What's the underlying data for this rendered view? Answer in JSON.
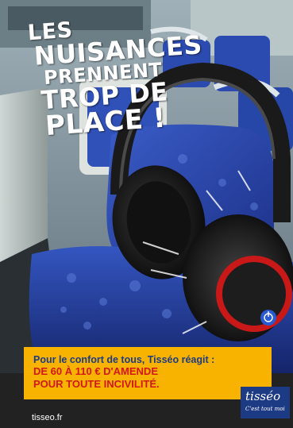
{
  "headline": {
    "line1": "LES",
    "line2": "NUISANCES",
    "line3": "PRENNENT",
    "line4": "TROP DE",
    "line5": "PLACE !"
  },
  "banner": {
    "lead": "Pour le confort de tous, Tisséo réagit :",
    "fine_line1": "DE 60 À 110 € D'AMENDE",
    "fine_line2": "POUR TOUTE INCIVILITÉ."
  },
  "logo": {
    "brand": "tisséo",
    "tagline": "C'est tout moi"
  },
  "footer": {
    "url": "tisseo.fr"
  },
  "colors": {
    "banner_bg": "#f7b300",
    "lead_text": "#1d3a84",
    "fine_text": "#d2171b",
    "logo_bg": "#1d3a84",
    "seat_blue": "#2a4ab0",
    "headphone_red": "#c81818"
  },
  "icons": {
    "power_button": "power-icon"
  }
}
